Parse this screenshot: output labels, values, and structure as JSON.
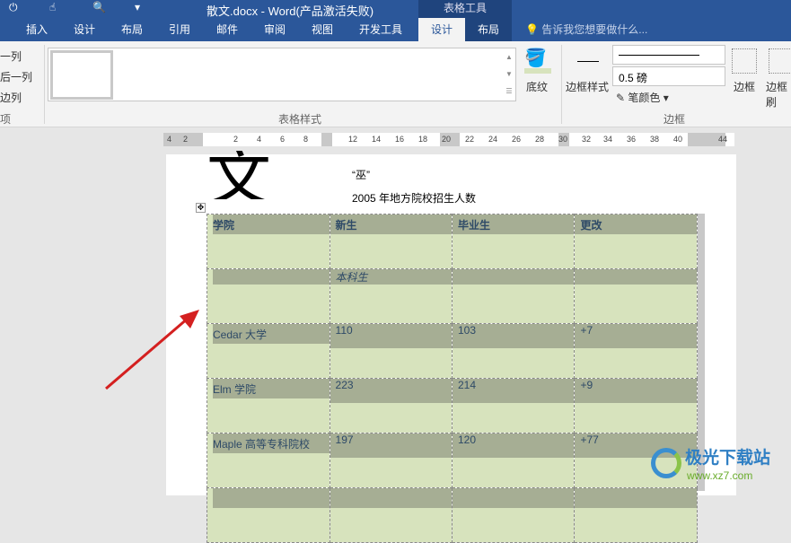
{
  "title": "散文.docx - Word(产品激活失败)",
  "tool_context": "表格工具",
  "tabs": [
    "插入",
    "设计",
    "布局",
    "引用",
    "邮件",
    "审阅",
    "视图",
    "开发工具",
    "设计",
    "布局"
  ],
  "tell_me": "告诉我您想要做什么...",
  "ribbon": {
    "left_options": [
      "一列",
      "后一列",
      "边列",
      "项"
    ],
    "group_table_styles": "表格样式",
    "shading": "底纹",
    "border_styles": "边框样式",
    "line_weight": "0.5 磅",
    "pen_color": "笔颜色",
    "borders": "边框",
    "border_painter": "边框刷",
    "group_borders": "边框"
  },
  "ruler": [
    "4",
    "2",
    "2",
    "4",
    "6",
    "8",
    "12",
    "14",
    "16",
    "18",
    "20",
    "22",
    "24",
    "26",
    "28",
    "30",
    "32",
    "34",
    "36",
    "38",
    "40",
    "44"
  ],
  "doc": {
    "quote": "“巫”",
    "caption": "2005 年地方院校招生人数"
  },
  "table": {
    "headers": [
      "学院",
      "新生",
      "毕业生",
      "更改"
    ],
    "subheader": "本科生",
    "rows": [
      [
        "Cedar 大学",
        "110",
        "103",
        "+7"
      ],
      [
        "Elm 学院",
        "223",
        "214",
        "+9"
      ],
      [
        "Maple 高等专科院校",
        "197",
        "120",
        "+77"
      ]
    ]
  },
  "watermark": {
    "name": "极光下载站",
    "url": "www.xz7.com"
  }
}
